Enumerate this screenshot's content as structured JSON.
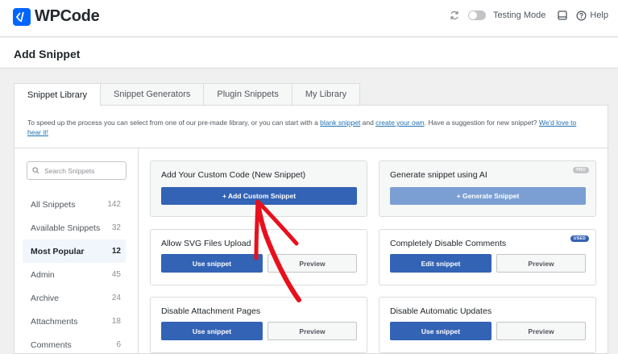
{
  "app": {
    "name": "WPCode"
  },
  "topbar": {
    "testing_label": "Testing Mode",
    "help_label": "Help"
  },
  "page": {
    "title": "Add Snippet"
  },
  "tabs": [
    {
      "label": "Snippet Library"
    },
    {
      "label": "Snippet Generators"
    },
    {
      "label": "Plugin Snippets"
    },
    {
      "label": "My Library"
    }
  ],
  "intro": {
    "text1": "To speed up the process you can select from one of our pre-made library, or you can start with a ",
    "link1": "blank snippet",
    "text2": " and ",
    "link2": "create your own",
    "text3": ". Have a suggestion for new snippet? ",
    "link3": "We'd love to hear it!"
  },
  "sidebar": {
    "search_placeholder": "Search Snippets",
    "categories": [
      {
        "label": "All Snippets",
        "count": "142"
      },
      {
        "label": "Available Snippets",
        "count": "32"
      },
      {
        "label": "Most Popular",
        "count": "12"
      },
      {
        "label": "Admin",
        "count": "45"
      },
      {
        "label": "Archive",
        "count": "24"
      },
      {
        "label": "Attachments",
        "count": "18"
      },
      {
        "label": "Comments",
        "count": "6"
      }
    ]
  },
  "cards": {
    "custom": {
      "title": "Add Your Custom Code (New Snippet)",
      "button": "+ Add Custom Snippet"
    },
    "ai": {
      "title": "Generate snippet using AI",
      "button": "+ Generate Snippet",
      "badge": "PRO"
    },
    "svg": {
      "title": "Allow SVG Files Upload",
      "primary": "Use snippet",
      "secondary": "Preview"
    },
    "comments": {
      "title": "Completely Disable Comments",
      "primary": "Edit snippet",
      "secondary": "Preview",
      "badge": "USED"
    },
    "attachment": {
      "title": "Disable Attachment Pages",
      "primary": "Use snippet",
      "secondary": "Preview"
    },
    "updates": {
      "title": "Disable Automatic Updates",
      "primary": "Use snippet",
      "secondary": "Preview"
    }
  },
  "colors": {
    "brand": "#0065ff",
    "primary_button": "#3363b5",
    "annotation_arrow": "#e8101c"
  }
}
